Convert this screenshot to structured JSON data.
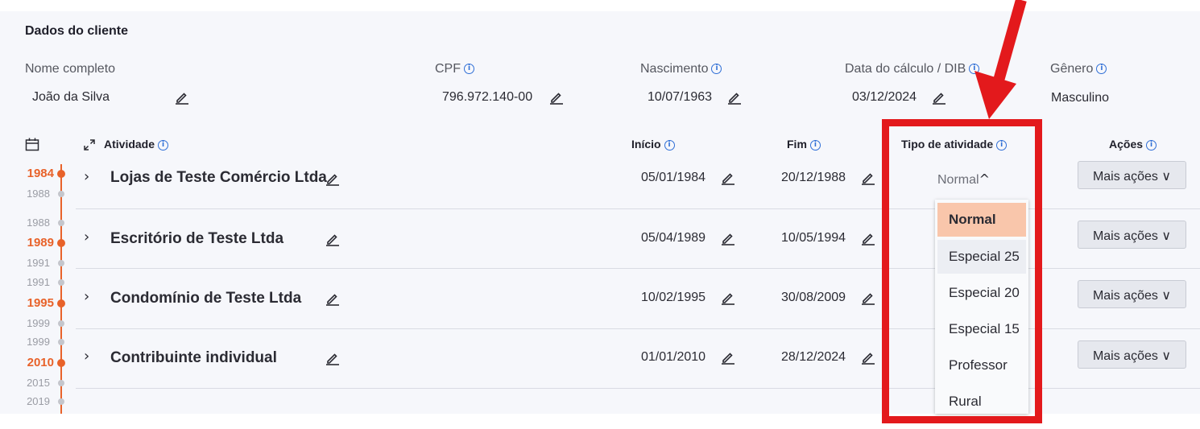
{
  "client": {
    "section_title": "Dados do cliente",
    "name_label": "Nome completo",
    "name_value": "João da Silva",
    "cpf_label": "CPF",
    "cpf_value": "796.972.140-00",
    "birth_label": "Nascimento",
    "birth_value": "10/07/1963",
    "calc_label": "Data do cálculo / DIB",
    "calc_value": "03/12/2024",
    "gender_label": "Gênero",
    "gender_value": "Masculino"
  },
  "table": {
    "col_activity": "Atividade",
    "col_start": "Início",
    "col_end": "Fim",
    "col_type": "Tipo de atividade",
    "col_actions": "Ações",
    "type_current": "Normal",
    "actions_label": "Mais ações",
    "rows": [
      {
        "name": "Lojas de Teste Comércio Ltda",
        "start": "05/01/1984",
        "end": "20/12/1988"
      },
      {
        "name": "Escritório de Teste Ltda",
        "start": "05/04/1989",
        "end": "10/05/1994"
      },
      {
        "name": "Condomínio de Teste Ltda",
        "start": "10/02/1995",
        "end": "30/08/2009"
      },
      {
        "name": "Contribuinte individual",
        "start": "01/01/2010",
        "end": "28/12/2024"
      }
    ]
  },
  "timeline": {
    "years": [
      "1984",
      "1988",
      "1988",
      "1989",
      "1991",
      "1991",
      "1995",
      "1999",
      "1999",
      "2010",
      "2015",
      "2019"
    ],
    "highlighted": [
      "1984",
      "1989",
      "1995",
      "2010"
    ]
  },
  "dropdown": {
    "options": [
      "Normal",
      "Especial 25",
      "Especial 20",
      "Especial 15",
      "Professor",
      "Rural"
    ],
    "selected": "Normal",
    "hovered": "Especial 25"
  },
  "colors": {
    "accent": "#e8622a",
    "annotation": "#e3191c",
    "info": "#2f6fd6",
    "selected_option": "#f9c6ab"
  }
}
